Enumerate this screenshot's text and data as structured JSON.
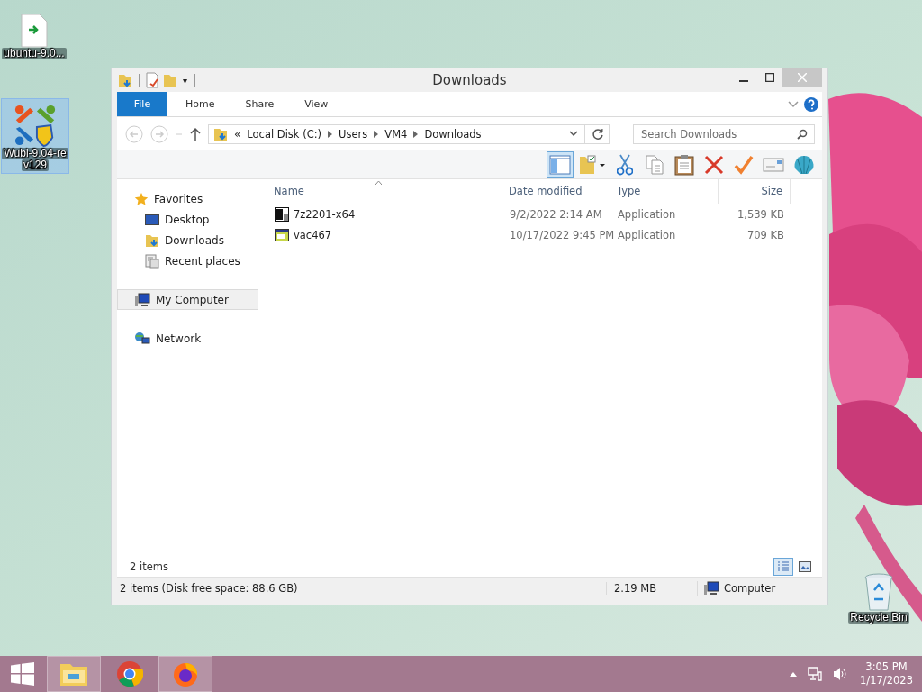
{
  "desktop_icons": [
    {
      "kind": "file",
      "label_lines": [
        "ubuntu-9.0..."
      ],
      "selected": false
    },
    {
      "kind": "installer",
      "label_lines": [
        "Wubi-9.04-re",
        "v129"
      ],
      "selected": true
    },
    {
      "kind": "recycle-bin",
      "label_lines": [
        "Recycle Bin"
      ],
      "selected": false
    }
  ],
  "window": {
    "title": "Downloads",
    "quick_access_menu": "▾",
    "ribbon_tabs": [
      {
        "label": "File",
        "kind": "file",
        "selected": false
      },
      {
        "label": "Home",
        "kind": "tab",
        "selected": false
      },
      {
        "label": "Share",
        "kind": "tab",
        "selected": false
      },
      {
        "label": "View",
        "kind": "tab",
        "selected": false
      }
    ],
    "address": {
      "overflow": "«",
      "crumbs": [
        "Local Disk (C:)",
        "Users",
        "VM4",
        "Downloads"
      ]
    },
    "search": {
      "placeholder": "Search Downloads"
    },
    "preview_pane": {
      "on": true
    },
    "toolbar": [
      {
        "kind": "folder-check"
      },
      {
        "kind": "cut"
      },
      {
        "kind": "copy"
      },
      {
        "kind": "paste"
      },
      {
        "kind": "delete"
      },
      {
        "kind": "check"
      },
      {
        "kind": "card"
      },
      {
        "kind": "shell"
      }
    ],
    "nav": [
      {
        "label": "Favorites",
        "kind": "star",
        "selected": false,
        "children": [
          {
            "label": "Desktop",
            "kind": "desktop",
            "selected": false
          },
          {
            "label": "Downloads",
            "kind": "downloads",
            "selected": false
          },
          {
            "label": "Recent places",
            "kind": "recent",
            "selected": false
          }
        ]
      },
      {
        "label": "My Computer",
        "kind": "computer",
        "selected": true
      },
      {
        "label": "Network",
        "kind": "network",
        "selected": false
      }
    ],
    "columns": [
      "Name",
      "Date modified",
      "Type",
      "Size"
    ],
    "rows": [
      {
        "kind": "sevenzip",
        "name": "7z2201-x64",
        "date": "9/2/2022 2:14 AM",
        "type": "Application",
        "size": "1,539 KB",
        "selected": false
      },
      {
        "kind": "app",
        "name": "vac467",
        "date": "10/17/2022 9:45 PM",
        "type": "Application",
        "size": "709 KB",
        "selected": false
      }
    ],
    "item_count": "2 items",
    "views": [
      {
        "kind": "details",
        "selected": true
      },
      {
        "kind": "large",
        "selected": false
      }
    ],
    "status": {
      "summary": "2 items (Disk free space: 88.6 GB)",
      "size": "2.19 MB",
      "location": "Computer"
    }
  },
  "taskbar": {
    "apps": [
      {
        "kind": "explorer",
        "selected": true
      },
      {
        "kind": "chrome",
        "selected": false
      },
      {
        "kind": "firefox",
        "selected": true
      }
    ],
    "time": "3:05 PM",
    "date": "1/17/2023"
  }
}
